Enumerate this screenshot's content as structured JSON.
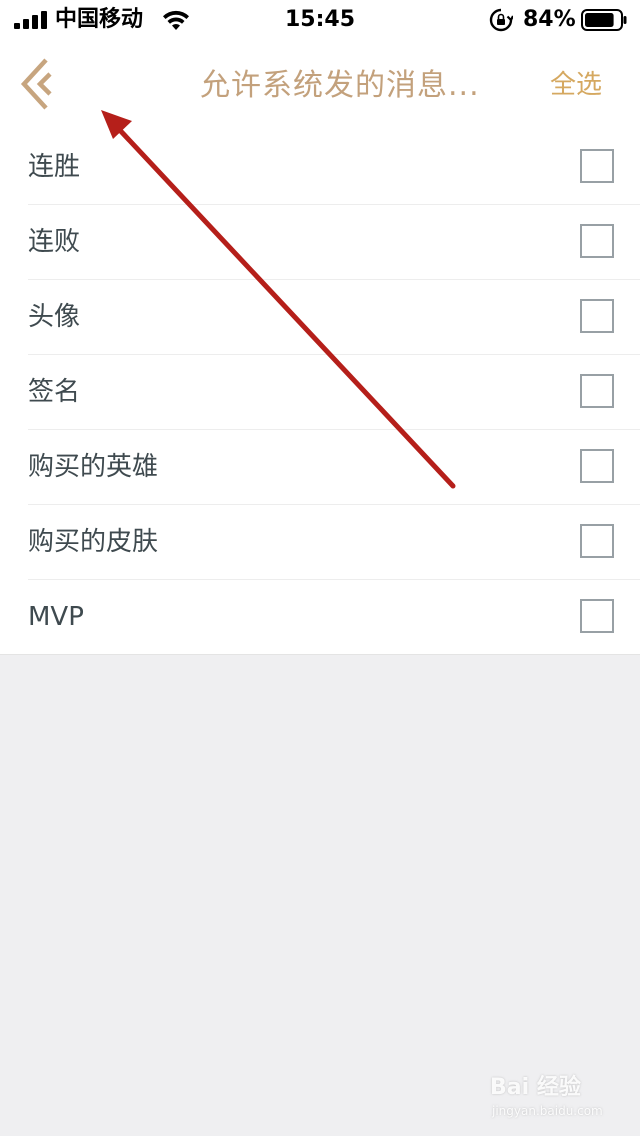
{
  "status_bar": {
    "carrier": "中国移动",
    "time": "15:45",
    "battery_percent": "84%",
    "battery_level": 0.84
  },
  "nav": {
    "title": "允许系统发的消息...",
    "select_all": "全选"
  },
  "items": [
    {
      "label": "连胜",
      "checked": false
    },
    {
      "label": "连败",
      "checked": false
    },
    {
      "label": "头像",
      "checked": false
    },
    {
      "label": "签名",
      "checked": false
    },
    {
      "label": "购买的英雄",
      "checked": false
    },
    {
      "label": "购买的皮肤",
      "checked": false
    },
    {
      "label": "MVP",
      "checked": false
    }
  ],
  "colors": {
    "title": "#c3a17c",
    "select_all": "#d5a860",
    "back_chevron": "#c7a57f",
    "annotation_arrow": "#b51f1a"
  },
  "watermark": {
    "main": "Bai 经验",
    "sub": "jingyan.baidu.com"
  }
}
